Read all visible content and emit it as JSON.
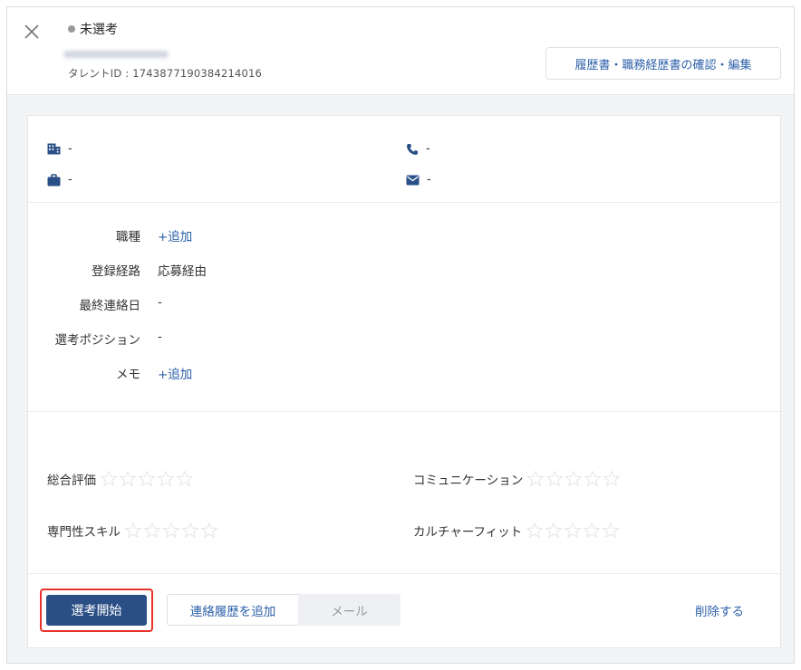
{
  "header": {
    "close_icon": "close-icon",
    "status_label": "未選考",
    "status_dot_color": "#999999",
    "talent_id": "タレントID : 1743877190384214016",
    "resume_button": "履歴書・職務経歴書の確認・編集"
  },
  "contact": {
    "company": {
      "icon": "building-icon",
      "value": "-"
    },
    "phone": {
      "icon": "phone-icon",
      "value": "-"
    },
    "job": {
      "icon": "briefcase-icon",
      "value": "-"
    },
    "email": {
      "icon": "envelope-icon",
      "value": "-"
    }
  },
  "fields": [
    {
      "label": "職種",
      "value": "+追加",
      "is_link": true
    },
    {
      "label": "登録経路",
      "value": "応募経由",
      "is_link": false
    },
    {
      "label": "最終連絡日",
      "value": "-",
      "is_link": false
    },
    {
      "label": "選考ポジション",
      "value": "-",
      "is_link": false
    },
    {
      "label": "メモ",
      "value": "+追加",
      "is_link": true
    }
  ],
  "ratings": [
    {
      "label": "総合評価",
      "stars": 5,
      "filled": 0
    },
    {
      "label": "コミュニケーション",
      "stars": 5,
      "filled": 0
    },
    {
      "label": "専門性スキル",
      "stars": 5,
      "filled": 0
    },
    {
      "label": "カルチャーフィット",
      "stars": 5,
      "filled": 0
    }
  ],
  "actions": {
    "start_button": "選考開始",
    "add_contact_button": "連絡履歴を追加",
    "mail_button": "メール",
    "delete_link": "削除する"
  },
  "colors": {
    "primary": "#2a4f86",
    "link": "#2b5fa8",
    "highlight": "#e8322b",
    "band": "#f3f4f6",
    "star_empty": "#e7e7e7"
  }
}
